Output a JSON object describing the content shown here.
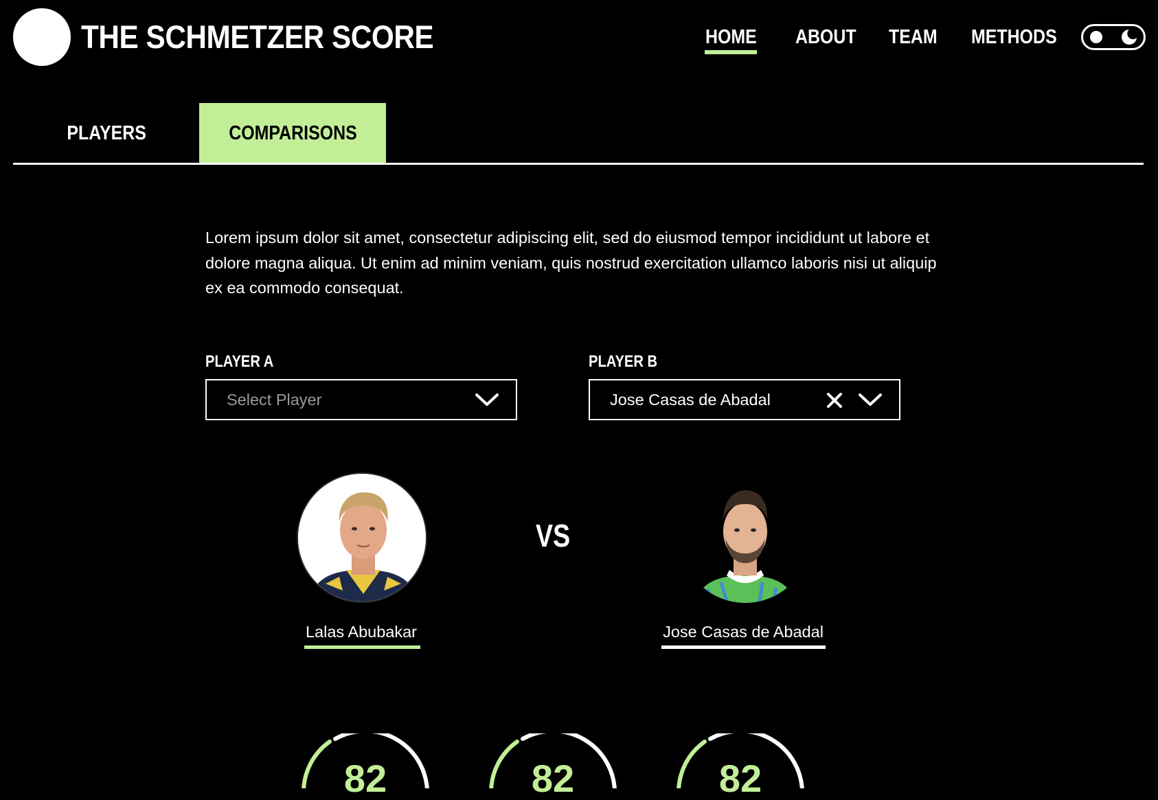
{
  "header": {
    "brand": "THE SCHMETZER SCORE",
    "nav": [
      {
        "label": "HOME",
        "active": true
      },
      {
        "label": "ABOUT"
      },
      {
        "label": "TEAM"
      },
      {
        "label": "METHODS"
      }
    ]
  },
  "tabs": [
    {
      "label": "PLAYERS",
      "active": false
    },
    {
      "label": "COMPARISONS",
      "active": true
    }
  ],
  "intro": "Lorem ipsum dolor sit amet, consectetur adipiscing elit, sed do eiusmod tempor incididunt ut labore et dolore magna aliqua. Ut enim ad minim veniam, quis nostrud exercitation ullamco laboris nisi ut aliquip ex ea commodo consequat.",
  "player_a": {
    "label": "PLAYER A",
    "placeholder": "Select Player",
    "name": "Lalas Abubakar"
  },
  "player_b": {
    "label": "PLAYER B",
    "value": "Jose Casas de Abadal",
    "name": "Jose Casas de Abadal"
  },
  "vs": "VS",
  "scores": [
    "82",
    "82",
    "82"
  ],
  "colors": {
    "accent": "#c2ee98",
    "background": "#000000",
    "text": "#ffffff"
  }
}
